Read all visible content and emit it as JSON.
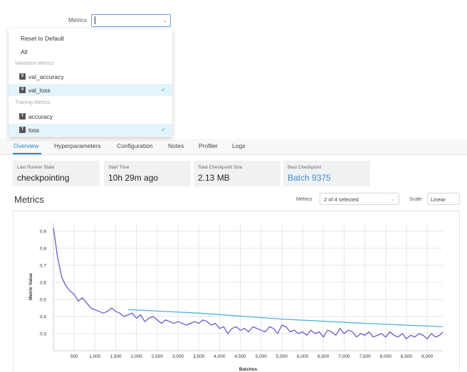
{
  "dropdown": {
    "label": "Metrics",
    "input_value": "",
    "reset_label": "Reset to Default",
    "all_label": "All",
    "groups": [
      {
        "name": "Validation Metrics",
        "items": [
          {
            "badge": "V",
            "name": "val_accuracy",
            "selected": false
          },
          {
            "badge": "V",
            "name": "val_loss",
            "selected": true
          }
        ]
      },
      {
        "name": "Training Metrics",
        "items": [
          {
            "badge": "T",
            "name": "accuracy",
            "selected": false
          },
          {
            "badge": "T",
            "name": "loss",
            "selected": true
          }
        ]
      }
    ],
    "check_glyph": "✓",
    "selected_bg": "#e3f4fb",
    "check_color": "#3aa0d8"
  },
  "tabs": [
    {
      "label": "Overview",
      "active": true
    },
    {
      "label": "Hyperparameters",
      "active": false
    },
    {
      "label": "Configuration",
      "active": false
    },
    {
      "label": "Notes",
      "active": false
    },
    {
      "label": "Profiler",
      "active": false
    },
    {
      "label": "Logs",
      "active": false
    }
  ],
  "cards": [
    {
      "label": "Last Runner State",
      "value": "checkpointing",
      "link": false
    },
    {
      "label": "Start Time",
      "value": "10h 29m ago",
      "link": false
    },
    {
      "label": "Total Checkpoint Size",
      "value": "2.13 MB",
      "link": false
    },
    {
      "label": "Best Checkpoint",
      "value": "Batch 9375",
      "link": true
    }
  ],
  "metrics_section": {
    "title": "Metrics",
    "metrics_label": "Metrics",
    "metrics_value": "2 of 4 selected",
    "scale_label": "Scale",
    "scale_value": "Linear"
  },
  "chart_data": {
    "type": "line",
    "xlabel": "Batches",
    "ylabel": "Metric Value",
    "xlim": [
      0,
      9375
    ],
    "ylim": [
      0.2,
      0.95
    ],
    "x_ticks": [
      500,
      1000,
      1500,
      2000,
      2500,
      3000,
      3500,
      4000,
      4500,
      5000,
      5500,
      6000,
      6500,
      7000,
      7500,
      8000,
      8500,
      9000
    ],
    "x_tick_labels": [
      "500",
      "1,000",
      "1,500",
      "2,000",
      "2,500",
      "3,000",
      "3,500",
      "4,000",
      "4,500",
      "5,000",
      "5,500",
      "6,000",
      "6,500",
      "7,000",
      "7,500",
      "8,000",
      "8,500",
      "9,000"
    ],
    "y_ticks": [
      0.3,
      0.4,
      0.5,
      0.6,
      0.7,
      0.8,
      0.9
    ],
    "y_tick_labels": [
      "0.3",
      "0.4",
      "0.5",
      "0.6",
      "0.7",
      "0.8",
      "0.9"
    ],
    "grid": true,
    "series": [
      {
        "color": "#6a5acd",
        "x": [
          0,
          100,
          200,
          300,
          400,
          500,
          600,
          700,
          800,
          900,
          1000,
          1100,
          1200,
          1300,
          1400,
          1500,
          1600,
          1700,
          1800,
          1900,
          2000,
          2100,
          2200,
          2300,
          2400,
          2500,
          2600,
          2700,
          2800,
          2900,
          3000,
          3100,
          3200,
          3300,
          3400,
          3500,
          3600,
          3700,
          3800,
          3900,
          4000,
          4100,
          4200,
          4300,
          4400,
          4500,
          4600,
          4700,
          4800,
          4900,
          5000,
          5100,
          5200,
          5300,
          5400,
          5500,
          5600,
          5700,
          5800,
          5900,
          6000,
          6100,
          6200,
          6300,
          6400,
          6500,
          6600,
          6700,
          6800,
          6900,
          7000,
          7100,
          7200,
          7300,
          7400,
          7500,
          7600,
          7700,
          7800,
          7900,
          8000,
          8100,
          8200,
          8300,
          8400,
          8500,
          8600,
          8700,
          8800,
          8900,
          9000,
          9100,
          9200,
          9300,
          9375
        ],
        "y": [
          0.92,
          0.75,
          0.63,
          0.58,
          0.55,
          0.53,
          0.49,
          0.51,
          0.48,
          0.45,
          0.44,
          0.43,
          0.42,
          0.43,
          0.45,
          0.43,
          0.42,
          0.4,
          0.41,
          0.42,
          0.39,
          0.41,
          0.37,
          0.39,
          0.4,
          0.38,
          0.36,
          0.38,
          0.37,
          0.36,
          0.37,
          0.36,
          0.35,
          0.36,
          0.37,
          0.36,
          0.38,
          0.37,
          0.35,
          0.36,
          0.33,
          0.34,
          0.3,
          0.33,
          0.34,
          0.32,
          0.33,
          0.31,
          0.34,
          0.33,
          0.32,
          0.31,
          0.34,
          0.33,
          0.3,
          0.35,
          0.34,
          0.31,
          0.32,
          0.3,
          0.31,
          0.29,
          0.32,
          0.3,
          0.31,
          0.28,
          0.32,
          0.31,
          0.29,
          0.33,
          0.3,
          0.32,
          0.31,
          0.28,
          0.3,
          0.29,
          0.31,
          0.28,
          0.29,
          0.3,
          0.28,
          0.31,
          0.29,
          0.28,
          0.3,
          0.27,
          0.29,
          0.28,
          0.3,
          0.29,
          0.27,
          0.3,
          0.28,
          0.29,
          0.31
        ]
      },
      {
        "color": "#4fb3d9",
        "x": [
          1800,
          3500,
          5500,
          7500,
          9375
        ],
        "y": [
          0.44,
          0.42,
          0.385,
          0.36,
          0.34
        ]
      }
    ]
  }
}
